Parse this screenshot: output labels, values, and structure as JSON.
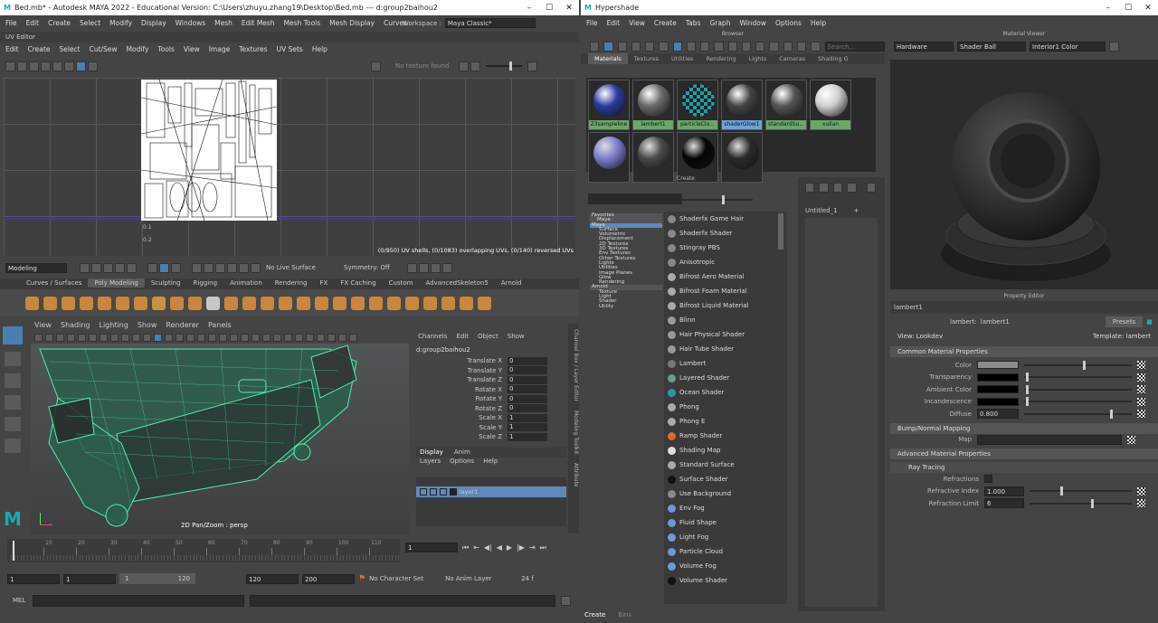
{
  "maya": {
    "title": "Bed.mb* - Autodesk MAYA 2022 - Educational Version: C:\\Users\\zhuyu.zhang19\\Desktop\\Bed.mb --- d:group2baihou2",
    "menu": [
      "File",
      "Edit",
      "Create",
      "Select",
      "Modify",
      "Display",
      "Windows",
      "Mesh",
      "Edit Mesh",
      "Mesh Tools",
      "Mesh Display",
      "Curves"
    ],
    "workspace_label": "Workspace :",
    "workspace_value": "Maya Classic*",
    "uv_editor_title": "UV Editor",
    "uv_menu": [
      "Edit",
      "Create",
      "Select",
      "Cut/Sew",
      "Modify",
      "Tools",
      "View",
      "Image",
      "Textures",
      "UV Sets",
      "Help"
    ],
    "uv_texture": "No texture found",
    "uv_status": "(0/950) UV shells, (0/1083) overlapping UVs, (0/140) reversed UVs",
    "uv_axis": [
      "0.1",
      "0.2"
    ],
    "mode_select": "Modeling",
    "live_surface": "No Live Surface",
    "symmetry": "Symmetry: Off",
    "shelf_tabs": [
      "Curves / Surfaces",
      "Poly Modeling",
      "Sculpting",
      "Rigging",
      "Animation",
      "Rendering",
      "FX",
      "FX Caching",
      "Custom",
      "AdvancedSkeleton5",
      "Arnold"
    ],
    "shelf_active": 1,
    "vp_menu": [
      "View",
      "Shading",
      "Lighting",
      "Show",
      "Renderer",
      "Panels"
    ],
    "vp_label": "2D Pan/Zoom : persp",
    "channel_menu": [
      "Channels",
      "Edit",
      "Object",
      "Show"
    ],
    "channel_object": "d:group2baihou2",
    "channels": [
      {
        "n": "Translate X",
        "v": "0"
      },
      {
        "n": "Translate Y",
        "v": "0"
      },
      {
        "n": "Translate Z",
        "v": "0"
      },
      {
        "n": "Rotate X",
        "v": "0"
      },
      {
        "n": "Rotate Y",
        "v": "0"
      },
      {
        "n": "Rotate Z",
        "v": "0"
      },
      {
        "n": "Scale X",
        "v": "1"
      },
      {
        "n": "Scale Y",
        "v": "1"
      },
      {
        "n": "Scale Z",
        "v": "1"
      }
    ],
    "side_tabs": [
      "Channel Box / Layer Editor",
      "Modeling Toolkit",
      "Attribute"
    ],
    "layer_tabs": [
      "Display",
      "Anim"
    ],
    "layer_menu": [
      "Layers",
      "Options",
      "Help"
    ],
    "layer_name": "layer1",
    "timeline_ticks": [
      "10",
      "20",
      "30",
      "40",
      "50",
      "60",
      "70",
      "80",
      "90",
      "100",
      "110"
    ],
    "current_frame": "1",
    "range_start": "1",
    "range_inner_start": "1",
    "range_slider_start": "1",
    "range_slider_end": "120",
    "range_inner_end": "120",
    "range_end": "200",
    "char_set": "No Character Set",
    "anim_layer": "No Anim Layer",
    "fps": "24 f",
    "cmd_label": "MEL"
  },
  "hypershade": {
    "title": "Hypershade",
    "menu": [
      "File",
      "Edit",
      "View",
      "Create",
      "Tabs",
      "Graph",
      "Window",
      "Options",
      "Help"
    ],
    "browser_title": "Browser",
    "search_placeholder": "Search...",
    "browser_tabs": [
      "Materials",
      "Textures",
      "Utilities",
      "Rendering",
      "Lights",
      "Cameras",
      "Shading G"
    ],
    "materials": [
      {
        "name": "Z3sampleline",
        "color": "#2d3aa0",
        "sel": false
      },
      {
        "name": "lambert1",
        "color": "#6a6a6a",
        "sel": false
      },
      {
        "name": "particleClo...",
        "color": "checker",
        "sel": false
      },
      {
        "name": "shaderGlow1",
        "color": "#444",
        "sel": true
      },
      {
        "name": "standardSu...",
        "color": "#555",
        "sel": false
      },
      {
        "name": "xuilan",
        "color": "#cfcfcf",
        "sel": false
      }
    ],
    "materials_row2": [
      "#7d7fcf",
      "#4a4a4a",
      "#050505",
      "#2b2b2b"
    ],
    "create_title": "Create",
    "tree": [
      "Favorites",
      "Maya",
      "Maya",
      "Surface",
      "Volumetric",
      "Displacement",
      "2D Textures",
      "3D Textures",
      "Env Textures",
      "Other Textures",
      "Lights",
      "Utilities",
      "Image Planes",
      "Glow",
      "Rendering",
      "Arnold",
      "Texture",
      "Light",
      "Shader",
      "Utility"
    ],
    "create_list": [
      "Shaderfx Game Hair",
      "Shaderfx Shader",
      "Stingray PBS",
      "Anisotropic",
      "Bifrost Aero Material",
      "Bifrost Foam Material",
      "Bifrost Liquid Material",
      "Blinn",
      "Hair Physical Shader",
      "Hair Tube Shader",
      "Lambert",
      "Layered Shader",
      "Ocean Shader",
      "Phong",
      "Phong E",
      "Ramp Shader",
      "Shading Map",
      "Standard Surface",
      "Surface Shader",
      "Use Background",
      "Env Fog",
      "Fluid Shape",
      "Light Fog",
      "Particle Cloud",
      "Volume Fog",
      "Volume Shader"
    ],
    "bottom_tabs": [
      "Create",
      "Bins"
    ],
    "graph_tab": "Untitled_1",
    "mv_title": "Material Viewer",
    "mv_renderer": "Hardware",
    "mv_shape": "Shader Ball",
    "mv_env": "Interior1 Color",
    "pe_title": "Property Editor",
    "pe_tab": "lambert1",
    "pe_node_label": "lambert:",
    "pe_node": "lambert1",
    "presets": "Presets",
    "view_label": "View: Lookdev",
    "template_label": "Template: lambert",
    "sections": [
      "Common Material Properties",
      "Bump/Normal Mapping",
      "Advanced Material Properties",
      "Ray Tracing"
    ],
    "common": [
      {
        "n": "Color",
        "sw": "#8a8a8a",
        "s": 0.55
      },
      {
        "n": "Transparency",
        "sw": "#000",
        "s": 0.02
      },
      {
        "n": "Ambient Color",
        "sw": "#000",
        "s": 0.02
      },
      {
        "n": "Incandescence",
        "sw": "#000",
        "s": 0.02
      },
      {
        "n": "Diffuse",
        "val": "0.800",
        "s": 0.8
      }
    ],
    "map_label": "Map",
    "ray": [
      {
        "n": "Refractions"
      },
      {
        "n": "Refractive Index",
        "val": "1.000",
        "s": 0.3
      },
      {
        "n": "Refraction Limit",
        "val": "6",
        "s": 0.6
      }
    ]
  }
}
